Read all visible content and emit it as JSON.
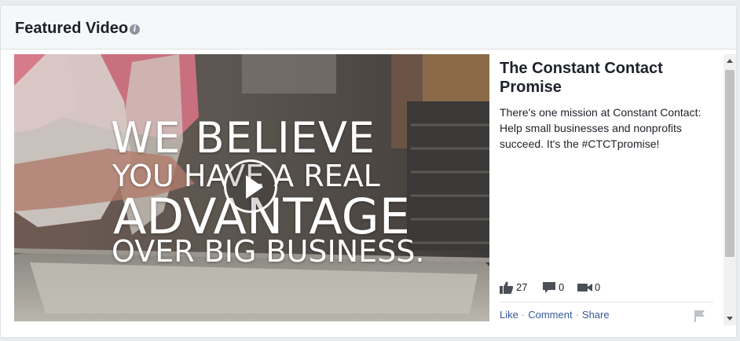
{
  "card": {
    "title": "Featured Video",
    "info_icon": "info-icon"
  },
  "video": {
    "overlay_lines": [
      "WE BELIEVE",
      "YOU HAVE A REAL",
      "ADVANTAGE",
      "OVER BIG BUSINESS."
    ],
    "play_icon": "play-icon",
    "title": "The Constant Contact Promise",
    "description": "There's one mission at Constant Contact: Help small businesses and nonprofits succeed. It's the #CTCTpromise!",
    "stats": {
      "likes": "27",
      "comments": "0",
      "views": "0",
      "like_icon": "thumbs-up-icon",
      "comment_icon": "comment-icon",
      "video_icon": "video-camera-icon"
    },
    "actions": {
      "like": "Like",
      "comment": "Comment",
      "share": "Share",
      "separator": "·",
      "flag_icon": "flag-icon"
    }
  },
  "colors": {
    "link": "#365899",
    "header_bg": "#f6f7f9",
    "text": "#1d2129"
  }
}
